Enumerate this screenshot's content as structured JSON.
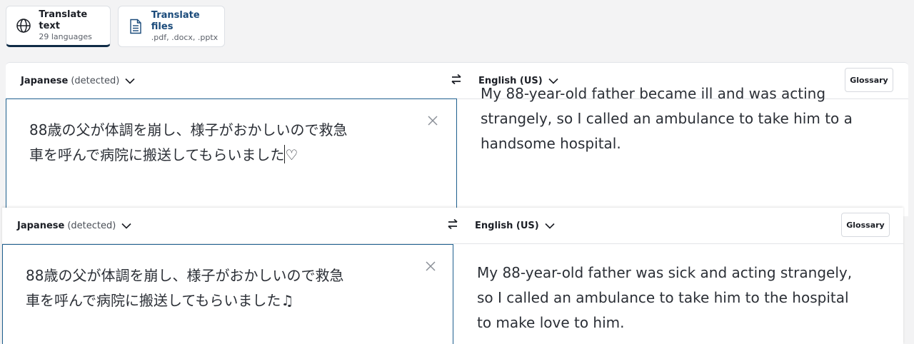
{
  "tabs": [
    {
      "title": "Translate text",
      "subtitle": "29 languages",
      "icon": "globe-icon",
      "active": true
    },
    {
      "title": "Translate files",
      "subtitle": ".pdf, .docx, .pptx",
      "icon": "document-icon",
      "active": false
    }
  ],
  "panels": [
    {
      "source_lang": "Japanese",
      "source_detected": "(detected)",
      "target_lang": "English (US)",
      "glossary_label": "Glossary",
      "source_line1": "88歳の父が体調を崩し、様子がおかしいので救急",
      "source_line2": "車を呼んで病院に搬送してもらいました",
      "source_suffix": "♡",
      "target_line1": "My 88-year-old father became ill and was acting",
      "target_line2": "strangely, so I called an ambulance to take him to a",
      "target_line3": "handsome hospital."
    },
    {
      "source_lang": "Japanese",
      "source_detected": "(detected)",
      "target_lang": "English (US)",
      "glossary_label": "Glossary",
      "source_line1": "88歳の父が体調を崩し、様子がおかしいので救急",
      "source_line2": "車を呼んで病院に搬送してもらいました",
      "source_suffix": "♫",
      "target_line1": "My 88-year-old father was sick and acting strangely,",
      "target_line2": "so I called an ambulance to take him to the hospital",
      "target_line3": "to make love to him."
    }
  ],
  "colors": {
    "accent": "#0f2b46",
    "source_border": "#1e5f8e",
    "background": "#f3f3f4"
  }
}
